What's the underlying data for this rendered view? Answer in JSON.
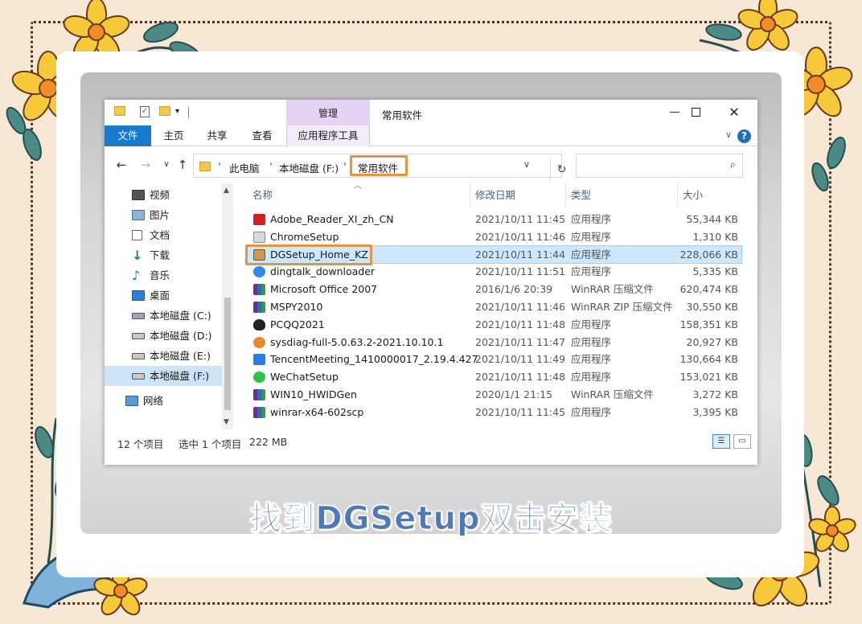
{
  "caption": "找到DGSetup双击安装",
  "window": {
    "title": "常用软件",
    "context_tab_group": "管理",
    "tabs": [
      {
        "label": "文件"
      },
      {
        "label": "主页"
      },
      {
        "label": "共享"
      },
      {
        "label": "查看"
      },
      {
        "label": "应用程序工具"
      }
    ],
    "buttons": {
      "minimize": "—",
      "maximize": "☐",
      "close": "✕"
    },
    "help": "?"
  },
  "address": {
    "crumbs": [
      "此电脑",
      "本地磁盘 (F:)",
      "常用软件"
    ],
    "search_placeholder": ""
  },
  "nav": {
    "items": [
      {
        "label": "视频",
        "icon": "video-icon"
      },
      {
        "label": "图片",
        "icon": "picture-icon"
      },
      {
        "label": "文档",
        "icon": "document-icon"
      },
      {
        "label": "下载",
        "icon": "download-icon"
      },
      {
        "label": "音乐",
        "icon": "music-icon"
      },
      {
        "label": "桌面",
        "icon": "desktop-icon"
      },
      {
        "label": "本地磁盘 (C:)",
        "icon": "drive-icon"
      },
      {
        "label": "本地磁盘 (D:)",
        "icon": "drive-icon"
      },
      {
        "label": "本地磁盘 (E:)",
        "icon": "drive-icon"
      },
      {
        "label": "本地磁盘 (F:)",
        "icon": "drive-icon",
        "selected": true
      },
      {
        "label": "网络",
        "icon": "network-icon"
      }
    ]
  },
  "columns": {
    "name": "名称",
    "date": "修改日期",
    "type": "类型",
    "size": "大小"
  },
  "files": [
    {
      "name": "Adobe_Reader_XI_zh_CN",
      "date": "2021/10/11 11:45",
      "type": "应用程序",
      "size": "55,344 KB",
      "icon": "adobe-icon"
    },
    {
      "name": "ChromeSetup",
      "date": "2021/10/11 11:46",
      "type": "应用程序",
      "size": "1,310 KB",
      "icon": "chrome-setup-icon"
    },
    {
      "name": "DGSetup_Home_KZ",
      "date": "2021/10/11 11:44",
      "type": "应用程序",
      "size": "228,066 KB",
      "icon": "dgsetup-icon",
      "selected": true
    },
    {
      "name": "dingtalk_downloader",
      "date": "2021/10/11 11:51",
      "type": "应用程序",
      "size": "5,335 KB",
      "icon": "dingtalk-icon"
    },
    {
      "name": "Microsoft Office 2007",
      "date": "2016/1/6 20:39",
      "type": "WinRAR 压缩文件",
      "size": "620,474 KB",
      "icon": "winrar-icon"
    },
    {
      "name": "MSPY2010",
      "date": "2021/10/11 11:46",
      "type": "WinRAR ZIP 压缩文件",
      "size": "30,550 KB",
      "icon": "winrar-icon"
    },
    {
      "name": "PCQQ2021",
      "date": "2021/10/11 11:48",
      "type": "应用程序",
      "size": "158,351 KB",
      "icon": "qq-icon"
    },
    {
      "name": "sysdiag-full-5.0.63.2-2021.10.10.1",
      "date": "2021/10/11 11:47",
      "type": "应用程序",
      "size": "20,927 KB",
      "icon": "sysdiag-icon"
    },
    {
      "name": "TencentMeeting_1410000017_2.19.4.427",
      "date": "2021/10/11 11:49",
      "type": "应用程序",
      "size": "130,664 KB",
      "icon": "tencent-meeting-icon"
    },
    {
      "name": "WeChatSetup",
      "date": "2021/10/11 11:48",
      "type": "应用程序",
      "size": "153,021 KB",
      "icon": "wechat-icon"
    },
    {
      "name": "WIN10_HWIDGen",
      "date": "2020/1/1 21:15",
      "type": "WinRAR 压缩文件",
      "size": "3,272 KB",
      "icon": "winrar-icon"
    },
    {
      "name": "winrar-x64-602scp",
      "date": "2021/10/11 11:45",
      "type": "应用程序",
      "size": "3,395 KB",
      "icon": "winrar-icon"
    }
  ],
  "status": {
    "count": "12 个项目",
    "selected": "选中 1 个项目",
    "size": "222 MB"
  },
  "colors": {
    "accent": "#1979ca",
    "highlight": "#e6943e",
    "caption": "#4d79b8",
    "frame": "#5a2e1c"
  }
}
